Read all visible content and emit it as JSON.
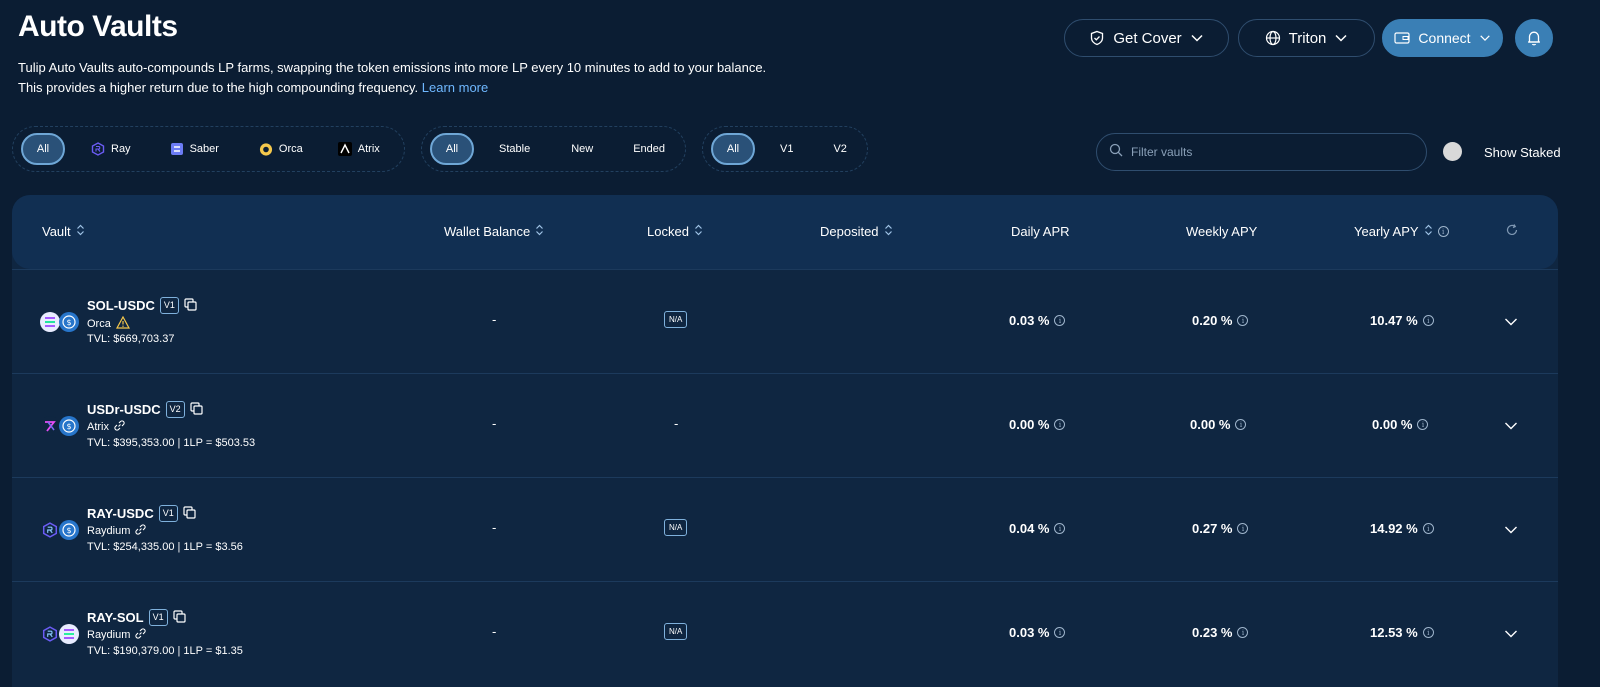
{
  "header": {
    "title": "Auto Vaults",
    "description_line1": "Tulip Auto Vaults auto-compounds LP farms, swapping the token emissions into more LP every 10 minutes to add to your balance.",
    "description_line2": "This provides a higher return due to the high compounding frequency.",
    "learn_more": "Learn more"
  },
  "topbar": {
    "get_cover": "Get Cover",
    "rpc": "Triton",
    "connect": "Connect"
  },
  "filters": {
    "platforms": [
      {
        "label": "All",
        "active": true
      },
      {
        "label": "Ray",
        "icon": "raydium-icon"
      },
      {
        "label": "Saber",
        "icon": "saber-icon"
      },
      {
        "label": "Orca",
        "icon": "orca-icon"
      },
      {
        "label": "Atrix",
        "icon": "atrix-icon"
      }
    ],
    "status": [
      {
        "label": "All",
        "active": true
      },
      {
        "label": "Stable"
      },
      {
        "label": "New"
      },
      {
        "label": "Ended"
      }
    ],
    "versions": [
      {
        "label": "All",
        "active": true
      },
      {
        "label": "V1"
      },
      {
        "label": "V2"
      }
    ],
    "search_placeholder": "Filter vaults",
    "show_staked": "Show Staked"
  },
  "table": {
    "columns": {
      "vault": "Vault",
      "wallet_balance": "Wallet Balance",
      "locked": "Locked",
      "deposited": "Deposited",
      "daily_apr": "Daily APR",
      "weekly_apy": "Weekly APY",
      "yearly_apy": "Yearly APY"
    },
    "rows": [
      {
        "name": "SOL-USDC",
        "version": "V1",
        "source": "Orca",
        "tvl": "TVL: $669,703.37",
        "wallet": "-",
        "locked": "N/A",
        "daily": "0.03 %",
        "weekly": "0.20 %",
        "yearly": "10.47 %"
      },
      {
        "name": "USDr-USDC",
        "version": "V2",
        "source": "Atrix",
        "tvl": "TVL: $395,353.00 | 1LP = $503.53",
        "wallet": "-",
        "locked": "-",
        "daily": "0.00 %",
        "weekly": "0.00 %",
        "yearly": "0.00 %"
      },
      {
        "name": "RAY-USDC",
        "version": "V1",
        "source": "Raydium",
        "tvl": "TVL: $254,335.00 | 1LP = $3.56",
        "wallet": "-",
        "locked": "N/A",
        "daily": "0.04 %",
        "weekly": "0.27 %",
        "yearly": "14.92 %"
      },
      {
        "name": "RAY-SOL",
        "version": "V1",
        "source": "Raydium",
        "tvl": "TVL: $190,379.00 | 1LP = $1.35",
        "wallet": "-",
        "locked": "N/A",
        "daily": "0.03 %",
        "weekly": "0.23 %",
        "yearly": "12.53 %"
      }
    ]
  },
  "colors": {
    "background": "#0b1d33",
    "accent": "#3a7fb5",
    "link": "#6fb8ff"
  }
}
